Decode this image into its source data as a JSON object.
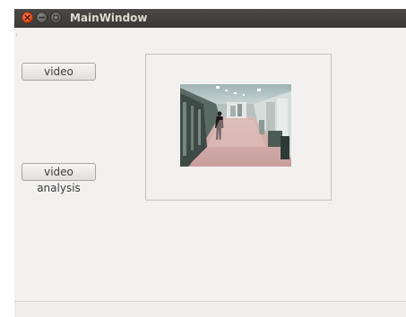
{
  "window": {
    "title": "MainWindow"
  },
  "buttons": {
    "video_label": "video",
    "analysis_label": "video analysis"
  },
  "video_display": {
    "icon": "video-frame-icon"
  },
  "colors": {
    "titlebar": "#3c3b37",
    "title_text": "#dfdbd2",
    "close_button": "#e0501f",
    "window_bg": "#f2f1f0"
  }
}
